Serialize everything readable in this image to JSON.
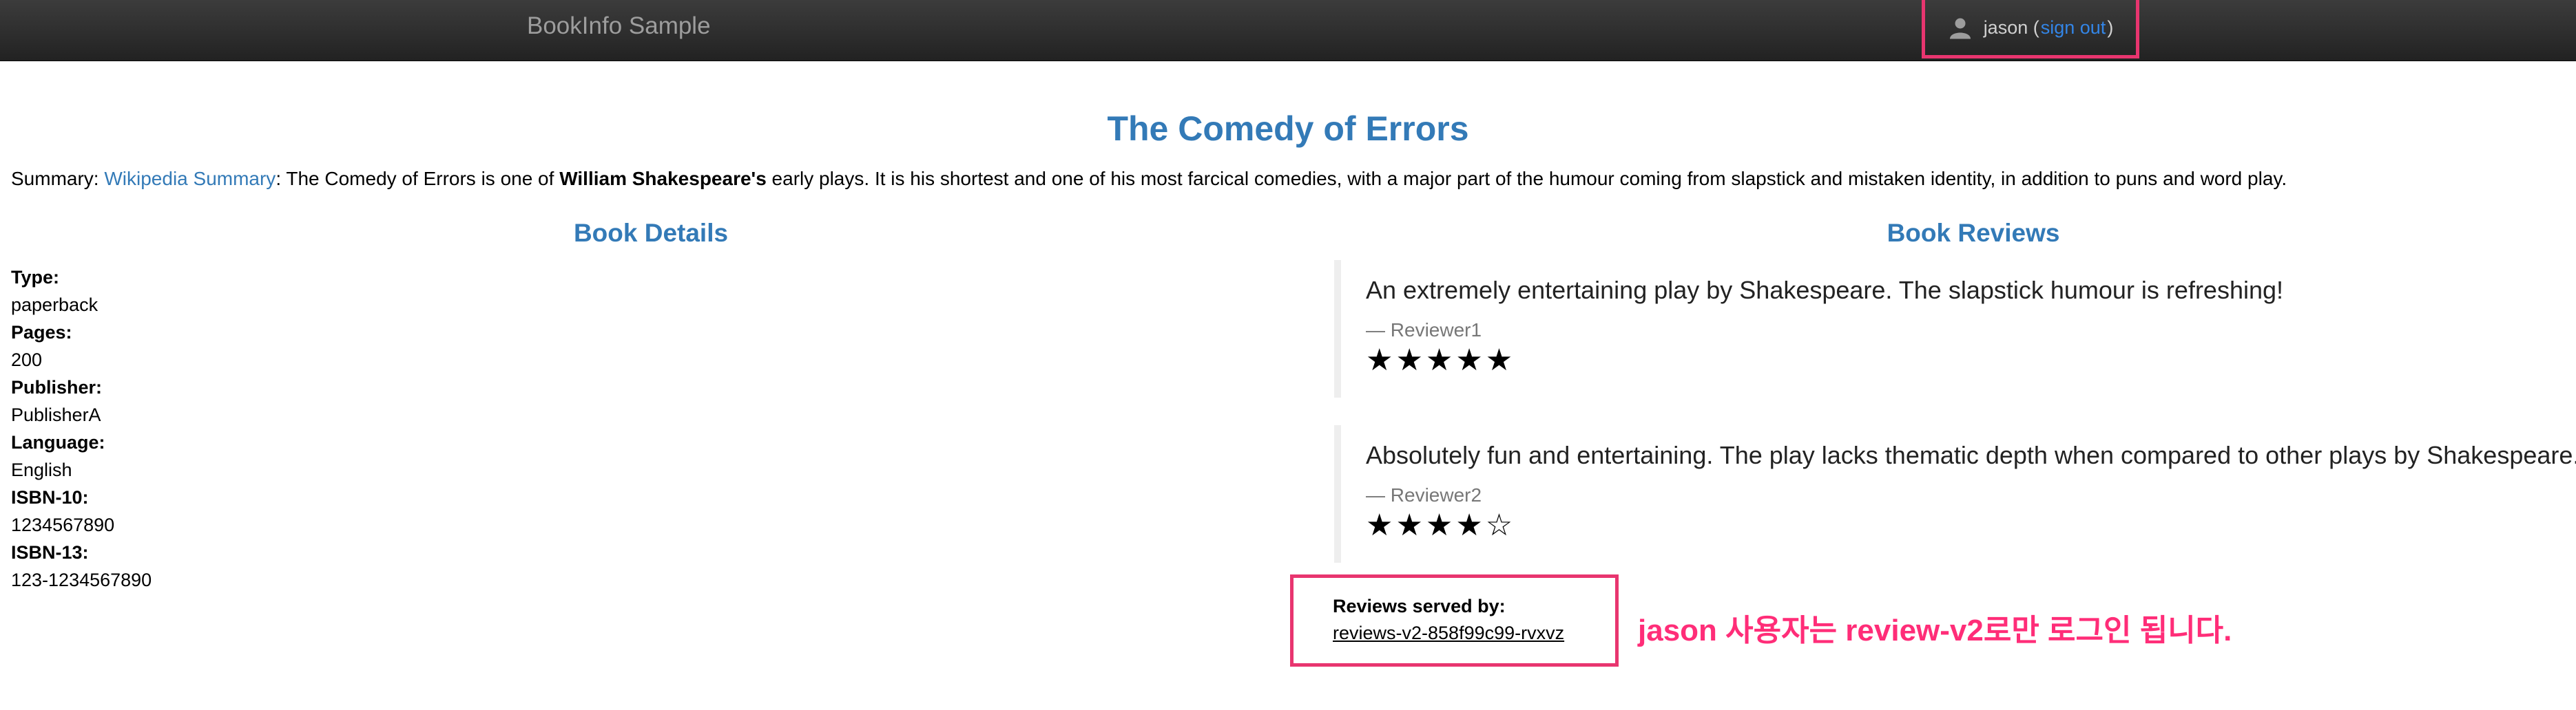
{
  "navbar": {
    "brand": "BookInfo Sample",
    "user_icon": "user-icon",
    "user_name": "jason (",
    "sign_out": "sign out",
    "user_close": ")"
  },
  "book": {
    "title": "The Comedy of Errors",
    "summary_label": "Summary: ",
    "summary_link": "Wikipedia Summary",
    "summary_text1": ": The Comedy of Errors is one of ",
    "summary_bold": "William Shakespeare's",
    "summary_text2": " early plays. It is his shortest and one of his most farcical comedies, with a major part of the humour coming from slapstick and mistaken identity, in addition to puns and word play."
  },
  "details": {
    "heading": "Book Details",
    "items": [
      {
        "term": "Type:",
        "value": "paperback"
      },
      {
        "term": "Pages:",
        "value": "200"
      },
      {
        "term": "Publisher:",
        "value": "PublisherA"
      },
      {
        "term": "Language:",
        "value": "English"
      },
      {
        "term": "ISBN-10:",
        "value": "1234567890"
      },
      {
        "term": "ISBN-13:",
        "value": "123-1234567890"
      }
    ]
  },
  "reviews": {
    "heading": "Book Reviews",
    "items": [
      {
        "text": "An extremely entertaining play by Shakespeare. The slapstick humour is refreshing!",
        "author": "— Reviewer1",
        "stars": "★★★★★",
        "rating": 5
      },
      {
        "text": "Absolutely fun and entertaining. The play lacks thematic depth when compared to other plays by Shakespeare.",
        "author": "— Reviewer2",
        "stars": "★★★★☆",
        "rating": 4
      }
    ],
    "served_by_label": "Reviews served by:",
    "served_by_value": "reviews-v2-858f99c99-rvxvz"
  },
  "annotation": "jason 사용자는 review-v2로만 로그인 됩니다.",
  "colors": {
    "accent": "#337ab7",
    "highlight": "#e8356f",
    "annotation": "#ff2d78",
    "navbar": "#222222"
  }
}
